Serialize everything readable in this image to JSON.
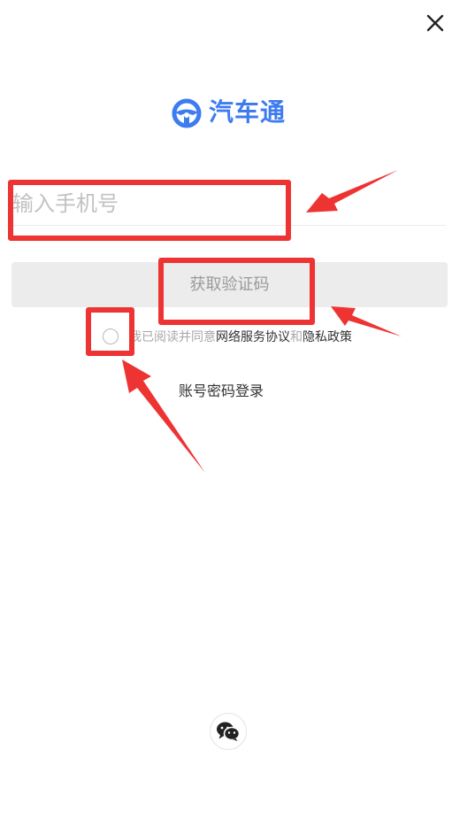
{
  "window": {
    "close_icon": "close-icon"
  },
  "brand": {
    "logo_icon": "steering-wheel-icon",
    "name": "汽车通",
    "color": "#3d7bf0"
  },
  "phone_field": {
    "placeholder": "输入手机号",
    "value": ""
  },
  "get_code_button": {
    "label": "获取验证码"
  },
  "agreement": {
    "checked": false,
    "prefix": "我已阅读并同意",
    "terms_link": "网络服务协议",
    "and_text": "和",
    "privacy_link": "隐私政策"
  },
  "alt_login": {
    "label": "账号密码登录"
  },
  "social_login": {
    "wechat_icon": "wechat-icon"
  },
  "annotations": {
    "color": "#ee3333"
  }
}
